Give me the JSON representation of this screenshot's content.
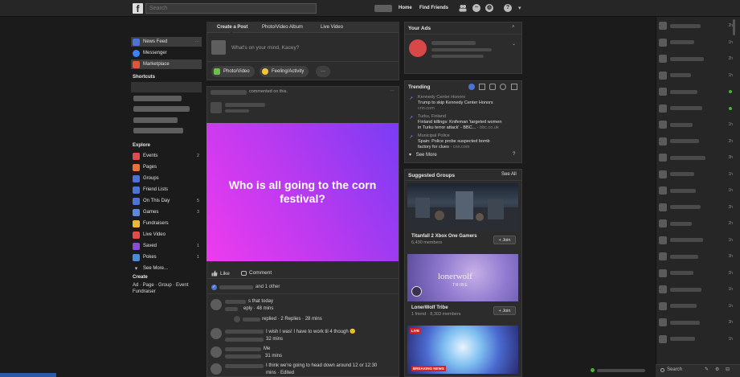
{
  "topbar": {
    "logo": "f",
    "search_placeholder": "Search",
    "links": [
      "Home",
      "Find Friends"
    ],
    "help_icon": "?"
  },
  "left_nav": {
    "main": [
      {
        "label": "News Feed",
        "color": "#4b74d6",
        "active": true
      },
      {
        "label": "Messenger",
        "color": "#3b82f6",
        "active": false
      },
      {
        "label": "Marketplace",
        "color": "#e0543a",
        "active": true
      }
    ],
    "shortcuts_title": "Shortcuts",
    "explore_title": "Explore",
    "explore": [
      {
        "label": "Events",
        "count": "2",
        "color": "#e14b4b"
      },
      {
        "label": "Pages",
        "count": "",
        "color": "#e8703a"
      },
      {
        "label": "Groups",
        "count": "",
        "color": "#4b74d6"
      },
      {
        "label": "Friend Lists",
        "count": "",
        "color": "#4b74d6"
      },
      {
        "label": "On This Day",
        "count": "5",
        "color": "#4b74d6"
      },
      {
        "label": "Games",
        "count": "3",
        "color": "#5b8ad9"
      },
      {
        "label": "Fundraisers",
        "count": "",
        "color": "#f0b43a"
      },
      {
        "label": "Live Video",
        "count": "",
        "color": "#e14b4b"
      },
      {
        "label": "Saved",
        "count": "1",
        "color": "#8a4bd6"
      },
      {
        "label": "Pokes",
        "count": "1",
        "color": "#4b8ad6"
      },
      {
        "label": "See More...",
        "count": "",
        "color": ""
      }
    ],
    "create_title": "Create",
    "create_links": "Ad · Page · Group · Event",
    "create_links_2": "Fundraiser"
  },
  "composer": {
    "tabs": [
      "Create a Post",
      "Photo/Video Album",
      "Live Video"
    ],
    "placeholder": "What's on your mind, Kacey?",
    "actions": [
      "Photo/Video",
      "Feeling/Activity"
    ],
    "more": "···"
  },
  "post": {
    "header_text": "commented on this.",
    "banner_text": "Who is all going to the corn festival?",
    "like": "Like",
    "comment": "Comment",
    "reactions_text": "and 1 other",
    "comments": [
      {
        "text": "s that today",
        "meta": "eply · 48 mins"
      },
      {
        "text": "replied · 2 Replies · 28 mins",
        "meta": ""
      },
      {
        "text": "I wish I was! I have to work til 4 though 🙁",
        "meta": "32 mins"
      },
      {
        "text": "Me",
        "meta": "31 mins"
      },
      {
        "text": "I think we're going to head down around 12 or 12:30",
        "meta": "mins · Edited"
      }
    ]
  },
  "right": {
    "ads_title": "Your Ads",
    "trending_title": "Trending",
    "trends": [
      {
        "topic": "Kennedy Center Honors",
        "lines": [
          "Trump to skip Kennedy Center Honors"
        ],
        "source": "cnn.com"
      },
      {
        "topic": "Turku, Finland",
        "lines": [
          "Finland killings: Knifeman 'targeted women",
          "in Turku terror attack' - BBC..."
        ],
        "source": "bbc.co.uk"
      },
      {
        "topic": "Municipal Police",
        "lines": [
          "Spain: Police probe suspected bomb",
          "factory for clues"
        ],
        "source": "cnn.com"
      }
    ],
    "see_more": "See More",
    "suggested_title": "Suggested Groups",
    "see_all": "See All",
    "groups": [
      {
        "name": "Titanfall 2 Xbox One Gamers",
        "meta": "6,430 members",
        "join": "Join"
      },
      {
        "name": "LonerWolf Tribe",
        "meta": "1 friend · 8,303 members",
        "join": "Join",
        "image_text": "lonerwolf",
        "image_subtext": "TRIBE"
      },
      {
        "name": "",
        "meta": "",
        "badge": "LIVE",
        "badge2": "BREAKING NEWS"
      }
    ]
  },
  "chat": {
    "search_placeholder": "Search",
    "times": [
      "2h",
      "1h",
      "2h",
      "1h",
      "",
      "",
      "1h",
      "2h",
      "3h",
      "1h",
      "1h",
      "2h",
      "2h",
      "1h",
      "3h",
      "2h",
      "1h",
      "1h",
      "3h",
      "1h"
    ]
  }
}
